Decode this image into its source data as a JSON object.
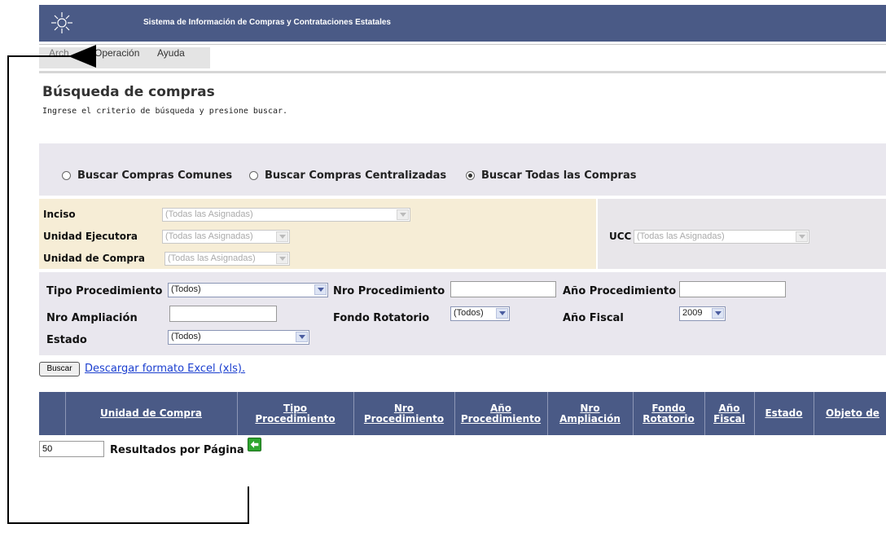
{
  "header": {
    "title": "Sistema de Información de Compras y Contrataciones Estatales",
    "logo_icon": "sun-emblem-icon"
  },
  "menu": {
    "items": [
      "Archivo",
      "Operación",
      "Ayuda"
    ],
    "archivo_visible": "Arch"
  },
  "page": {
    "title": "Búsqueda de compras",
    "subtitle": "Ingrese el criterio de búsqueda y presione buscar."
  },
  "search_type": {
    "options": [
      "Buscar Compras Comunes",
      "Buscar Compras Centralizadas",
      "Buscar Todas las Compras"
    ],
    "selected": "Buscar Todas las Compras"
  },
  "org": {
    "inciso_label": "Inciso",
    "inciso_value": "(Todas las Asignadas)",
    "unidad_ejecutora_label": "Unidad Ejecutora",
    "unidad_ejecutora_value": "(Todas las Asignadas)",
    "unidad_compra_label": "Unidad de Compra",
    "unidad_compra_value": "(Todas las Asignadas)",
    "ucc_label": "UCC",
    "ucc_value": "(Todas las Asignadas)"
  },
  "filters": {
    "tipo_procedimiento_label": "Tipo Procedimiento",
    "tipo_procedimiento_value": "(Todos)",
    "nro_procedimiento_label": "Nro Procedimiento",
    "nro_procedimiento_value": "",
    "anio_procedimiento_label": "Año Procedimiento",
    "anio_procedimiento_value": "",
    "nro_ampliacion_label": "Nro Ampliación",
    "nro_ampliacion_value": "",
    "fondo_rotatorio_label": "Fondo Rotatorio",
    "fondo_rotatorio_value": "(Todos)",
    "anio_fiscal_label": "Año Fiscal",
    "anio_fiscal_value": "2009",
    "estado_label": "Estado",
    "estado_value": "(Todos)"
  },
  "actions": {
    "buscar_label": "Buscar",
    "excel_link": "Descargar formato Excel (xls)."
  },
  "results": {
    "columns": {
      "unidad_compra": "Unidad de Compra",
      "tipo_proc_1": "Tipo",
      "tipo_proc_2": "Procedimiento",
      "nro_proc_1": "Nro",
      "nro_proc_2": "Procedimiento",
      "anio_proc_1": "Año",
      "anio_proc_2": "Procedimiento",
      "nro_amp_1": "Nro",
      "nro_amp_2": "Ampliación",
      "fondo_1": "Fondo",
      "fondo_2": "Rotatorio",
      "anio_fiscal_1": "Año",
      "anio_fiscal_2": "Fiscal",
      "estado": "Estado",
      "objeto": "Objeto de"
    }
  },
  "pagination": {
    "page_size": "50",
    "label": "Resultados por Página"
  },
  "colors": {
    "header_bg": "#4a5a86",
    "org_bg": "#f6edd6",
    "filter_bg": "#e9e7ee",
    "link": "#1a3ecf"
  }
}
